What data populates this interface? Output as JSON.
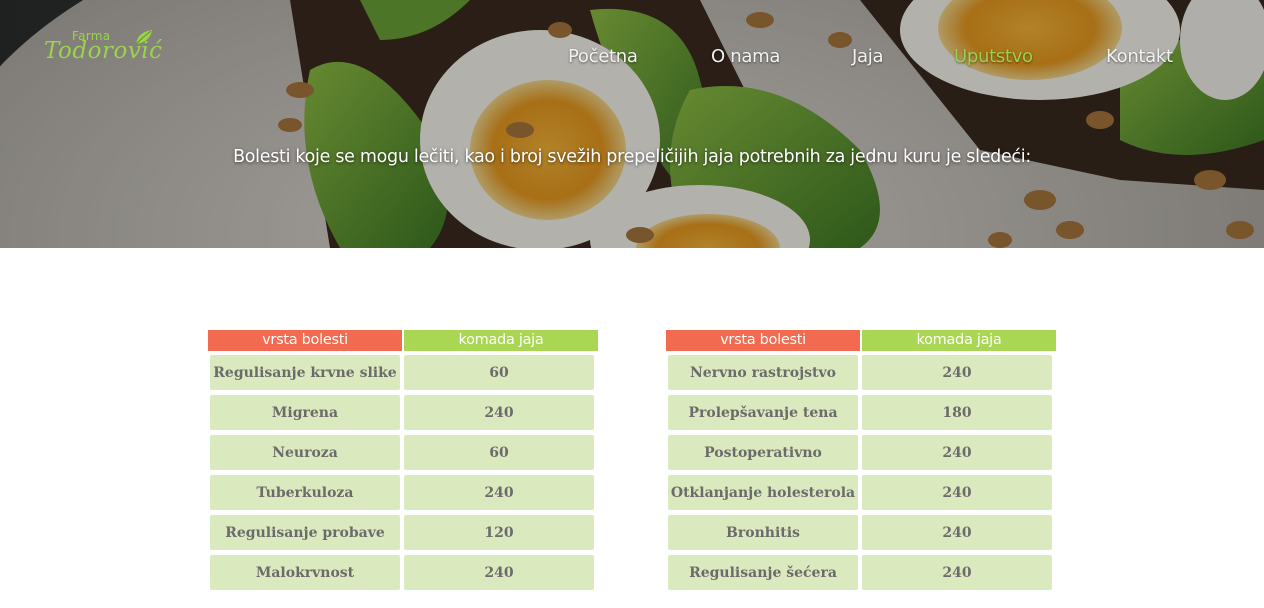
{
  "logo": {
    "small": "Farma",
    "big": "Todorović"
  },
  "nav": [
    {
      "label": "Početna",
      "active": false
    },
    {
      "label": "O nama",
      "active": false
    },
    {
      "label": "Jaja",
      "active": false
    },
    {
      "label": "Uputstvo",
      "active": true
    },
    {
      "label": "Kontakt",
      "active": false
    }
  ],
  "hero": {
    "heading": "Bolesti koje se mogu lečiti, kao i broj svežih prepeličijih jaja potrebnih za jednu kuru je sledeći:"
  },
  "tables": [
    {
      "headers": [
        "vrsta bolesti",
        "komada jaja"
      ],
      "rows": [
        [
          "Regulisanje krvne slike",
          "60"
        ],
        [
          "Migrena",
          "240"
        ],
        [
          "Neuroza",
          "60"
        ],
        [
          "Tuberkuloza",
          "240"
        ],
        [
          "Regulisanje probave",
          "120"
        ],
        [
          "Malokrvnost",
          "240"
        ]
      ]
    },
    {
      "headers": [
        "vrsta bolesti",
        "komada jaja"
      ],
      "rows": [
        [
          "Nervno rastrojstvo",
          "240"
        ],
        [
          "Prolepšavanje tena",
          "180"
        ],
        [
          "Postoperativno",
          "240"
        ],
        [
          "Otklanjanje holesterola",
          "240"
        ],
        [
          "Bronhitis",
          "240"
        ],
        [
          "Regulisanje šećera",
          "240"
        ]
      ]
    }
  ],
  "colors": {
    "accent_green": "#9bd44a",
    "header_left": "#f26a4f",
    "header_right": "#a9d653",
    "cell_bg": "#dbe9bf"
  }
}
